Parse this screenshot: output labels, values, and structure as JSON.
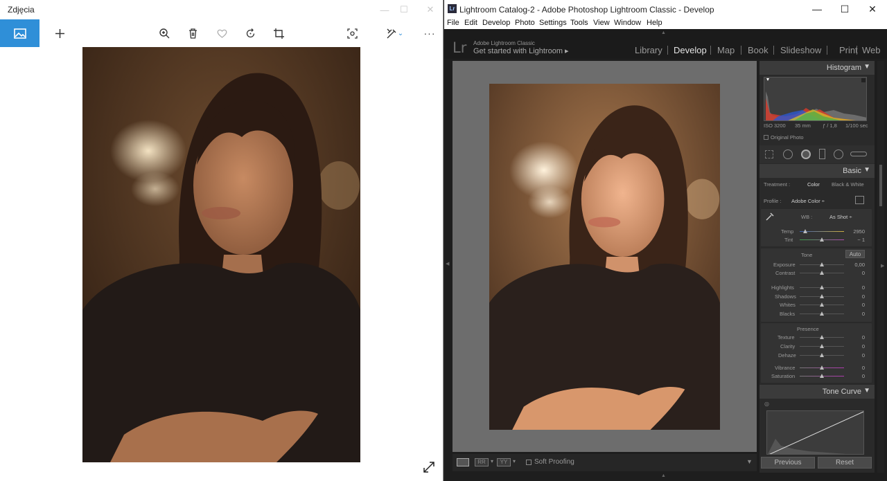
{
  "photos": {
    "window_title": "Zdjęcia",
    "icons": [
      "image-icon",
      "plus-icon",
      "zoom-icon",
      "trash-icon",
      "heart-icon",
      "rotate-icon",
      "crop-icon",
      "slideshow-icon",
      "edit-icon",
      "more-icon",
      "expand-icon"
    ],
    "more": "···"
  },
  "lightroom": {
    "window_title": "Lightroom Catalog-2 - Adobe Photoshop Lightroom Classic - Develop",
    "menu": [
      "File",
      "Edit",
      "Develop",
      "Photo",
      "Settings",
      "Tools",
      "View",
      "Window",
      "Help"
    ],
    "identity": {
      "logo": "Lr",
      "small": "Adobe Lightroom Classic",
      "big": "Get started with Lightroom  ▸"
    },
    "modules": [
      "Library",
      "Develop",
      "Map",
      "Book",
      "Slideshow",
      "Print",
      "Web"
    ],
    "active_module": "Develop",
    "histogram": {
      "header": "Histogram",
      "iso": "ISO 3200",
      "focal": "35 mm",
      "aperture": "ƒ / 1,8",
      "shutter": "1/100 sec",
      "original_photo": "Original Photo"
    },
    "basic": {
      "header": "Basic",
      "treatment_label": "Treatment :",
      "treatment_color": "Color",
      "treatment_bw": "Black & White",
      "profile_label": "Profile :",
      "profile_value": "Adobe Color ÷",
      "wb_label": "WB :",
      "wb_value": "As Shot ÷",
      "temp_label": "Temp",
      "temp_value": "2950",
      "tint_label": "Tint",
      "tint_value": "− 1",
      "tone_label": "Tone",
      "auto_label": "Auto",
      "exposure_label": "Exposure",
      "exposure_value": "0,00",
      "contrast_label": "Contrast",
      "contrast_value": "0",
      "highlights_label": "Highlights",
      "highlights_value": "0",
      "shadows_label": "Shadows",
      "shadows_value": "0",
      "whites_label": "Whites",
      "whites_value": "0",
      "blacks_label": "Blacks",
      "blacks_value": "0",
      "presence_label": "Presence",
      "texture_label": "Texture",
      "texture_value": "0",
      "clarity_label": "Clarity",
      "clarity_value": "0",
      "dehaze_label": "Dehaze",
      "dehaze_value": "0",
      "vibrance_label": "Vibrance",
      "vibrance_value": "0",
      "saturation_label": "Saturation",
      "saturation_value": "0"
    },
    "tone_curve": {
      "header": "Tone Curve"
    },
    "toolbar": {
      "soft_proofing": "Soft Proofing"
    },
    "buttons": {
      "previous": "Previous",
      "reset": "Reset"
    }
  },
  "colors": {
    "accent_blue": "#2f8fd8",
    "lr_bg": "#1e1e1e",
    "lr_gray": "#6d6d6d"
  }
}
